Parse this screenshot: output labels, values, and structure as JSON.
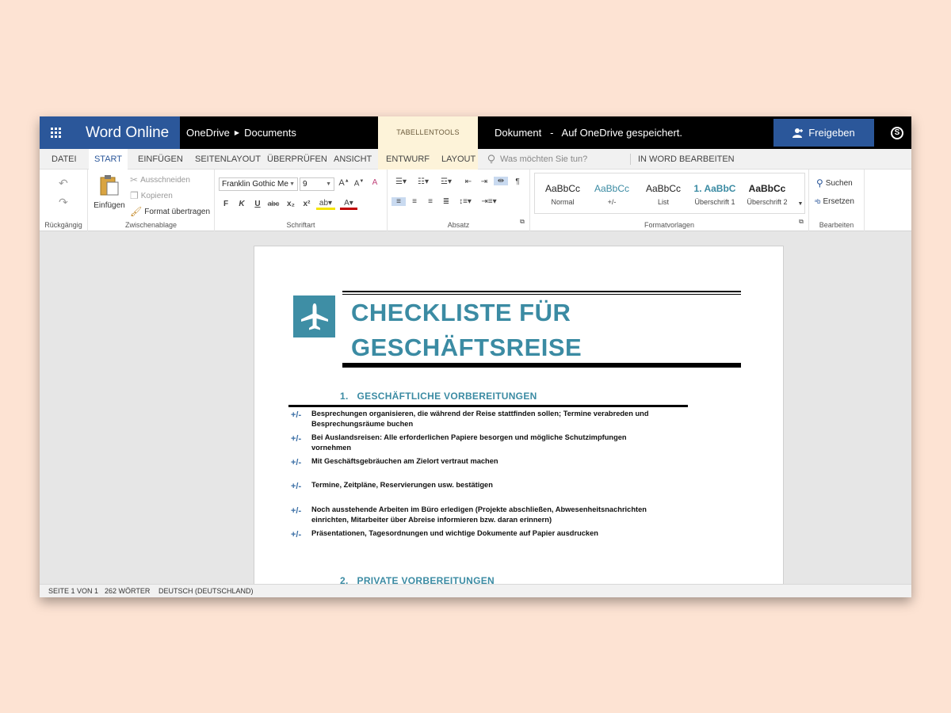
{
  "titlebar": {
    "app_name": "Word Online",
    "breadcrumb": [
      "OneDrive",
      "Documents"
    ],
    "context_tools": "TABELLENTOOLS",
    "doc_status": "Dokument   -   Auf OneDrive gespeichert.",
    "share_label": "Freigeben"
  },
  "tabs": [
    "DATEI",
    "START",
    "EINFÜGEN",
    "SEITENLAYOUT",
    "ÜBERPRÜFEN",
    "ANSICHT",
    "ENTWURF",
    "LAYOUT"
  ],
  "active_tab": "START",
  "tell_me_placeholder": "Was möchten Sie tun?",
  "edit_in_word": "IN WORD BEARBEITEN",
  "ribbon": {
    "undo_group": "Rückgängig",
    "clipboard": {
      "label": "Zwischenablage",
      "paste": "Einfügen",
      "cut": "Ausschneiden",
      "copy": "Kopieren",
      "format_painter": "Format übertragen"
    },
    "font": {
      "label": "Schriftart",
      "name": "Franklin Gothic Me",
      "size": "9",
      "bold": "F",
      "italic": "K",
      "underline": "U",
      "strike": "abc",
      "subscript": "x₂",
      "superscript": "x²"
    },
    "paragraph": {
      "label": "Absatz"
    },
    "styles": {
      "label": "Formatvorlagen",
      "items": [
        {
          "sample": "AaBbCc",
          "name": "Normal"
        },
        {
          "sample": "AaBbCc",
          "name": "+/-"
        },
        {
          "sample": "AaBbCc",
          "name": "List"
        },
        {
          "sample": "1. AaBbC",
          "name": "Überschrift 1"
        },
        {
          "sample": "AaBbCc",
          "name": "Überschrift 2"
        }
      ]
    },
    "editing": {
      "label": "Bearbeiten",
      "find": "Suchen",
      "replace": "Ersetzen"
    }
  },
  "document": {
    "title_line1": "CHECKLISTE FÜR",
    "title_line2": "GESCHÄFTSREISE",
    "section1": "1.   GESCHÄFTLICHE VORBEREITUNGEN",
    "items": [
      {
        "mark": "+/-",
        "text": "Besprechungen organisieren, die während der Reise stattfinden sollen; Termine verabreden und Besprechungsräume buchen"
      },
      {
        "mark": "+/-",
        "text": "Bei Auslandsreisen: Alle erforderlichen Papiere besorgen und mögliche Schutzimpfungen vornehmen"
      },
      {
        "mark": "+/-",
        "text": "Mit Geschäftsgebräuchen am Zielort vertraut machen"
      },
      {
        "mark": "+/-",
        "text": "Termine, Zeitpläne, Reservierungen usw. bestätigen"
      },
      {
        "mark": "+/-",
        "text": "Noch ausstehende Arbeiten im Büro erledigen (Projekte abschließen, Abwesenheitsnachrichten einrichten, Mitarbeiter über Abreise informieren bzw. daran erinnern)"
      },
      {
        "mark": "+/-",
        "text": "Präsentationen, Tagesordnungen und wichtige Dokumente auf Papier ausdrucken"
      }
    ],
    "section2": "2.   PRIVATE VORBEREITUNGEN"
  },
  "statusbar": {
    "page": "SEITE 1 VON 1",
    "words": "262 WÖRTER",
    "language": "DEUTSCH (DEUTSCHLAND)"
  },
  "colors": {
    "brand": "#2b579a",
    "accent": "#3b8ba3",
    "page_bg": "#fde3d3"
  }
}
